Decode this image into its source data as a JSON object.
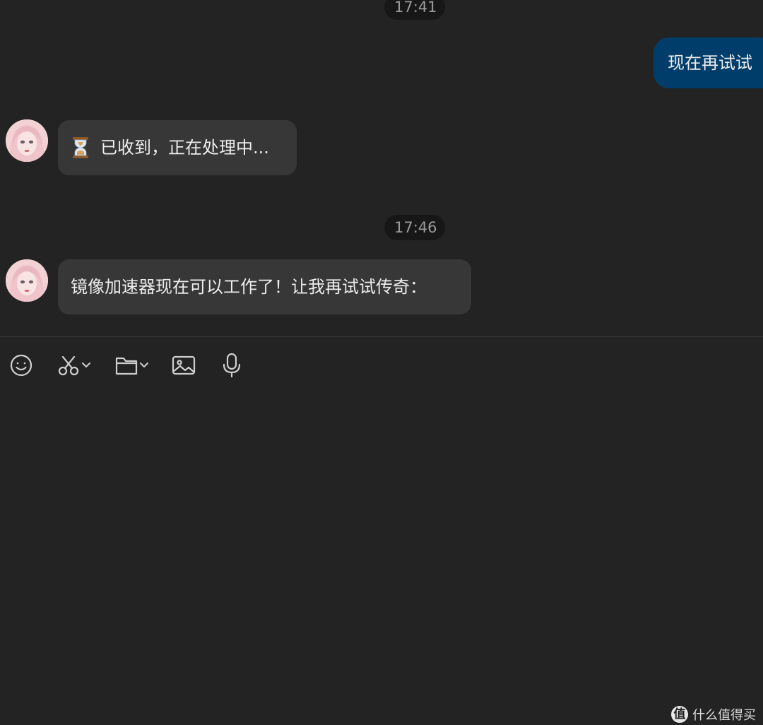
{
  "chat": {
    "timestamps": [
      "17:41",
      "17:46"
    ],
    "messages": [
      {
        "direction": "outgoing",
        "text": "现在再试试"
      },
      {
        "direction": "incoming",
        "icon": "hourglass-icon",
        "text": "已收到，正在处理中..."
      },
      {
        "direction": "incoming",
        "text": "镜像加速器现在可以工作了！让我再试试传奇："
      }
    ]
  },
  "toolbar": {
    "items": [
      {
        "name": "emoji-icon"
      },
      {
        "name": "scissors-icon",
        "has_dropdown": true
      },
      {
        "name": "folder-icon",
        "has_dropdown": true
      },
      {
        "name": "image-icon"
      },
      {
        "name": "microphone-icon"
      }
    ]
  },
  "watermark": {
    "logo": "值",
    "text": "什么值得买"
  },
  "colors": {
    "background": "#232323",
    "outgoing_bubble": "#013d6a",
    "incoming_bubble": "#373737",
    "timestamp_pill": "#171717",
    "text": "#ededed",
    "timestamp_text": "#9a9a9a"
  }
}
